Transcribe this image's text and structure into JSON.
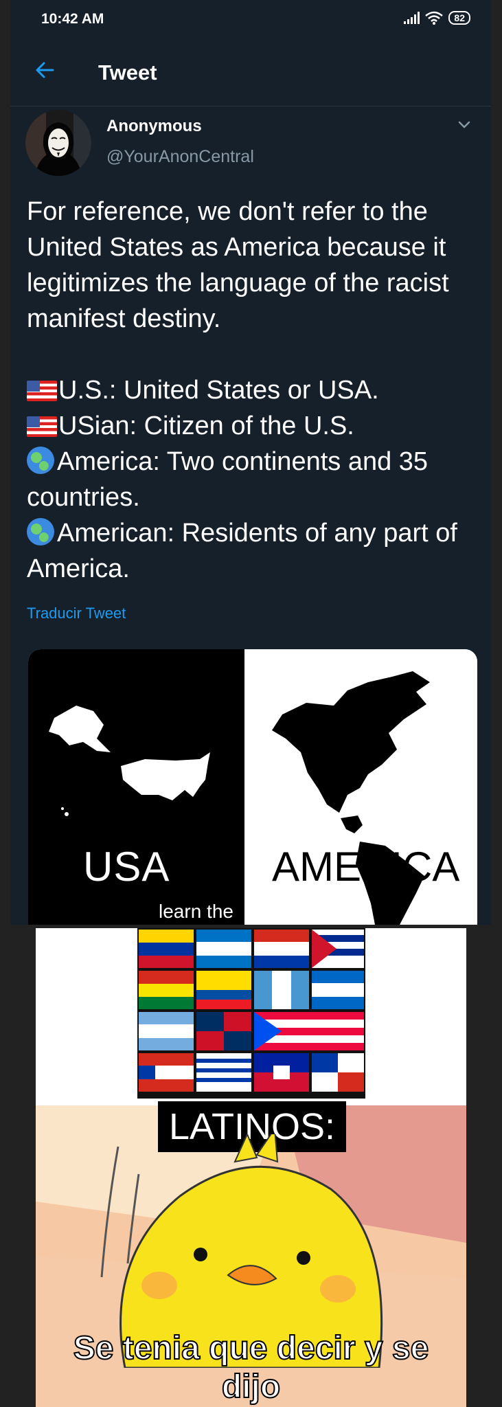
{
  "status_bar": {
    "time": "10:42 AM",
    "battery": "82"
  },
  "header": {
    "title": "Tweet"
  },
  "tweet": {
    "author_name": "Anonymous",
    "author_handle": "@YourAnonCentral",
    "text_intro": "For reference, we don't refer to the United States as America because it legitimizes the language of the racist manifest destiny.",
    "definitions": [
      {
        "icon": "us-flag-emoji",
        "text": "U.S.: United States or USA."
      },
      {
        "icon": "us-flag-emoji",
        "text": "USian: Citizen of the U.S."
      },
      {
        "icon": "globe-americas-emoji",
        "text": "America: Two continents and 35 countries."
      },
      {
        "icon": "globe-americas-emoji",
        "text": "American: Residents of any part of America."
      }
    ],
    "translate_label": "Traducir Tweet"
  },
  "image1": {
    "left_label": "USA",
    "right_label": "AMERICA",
    "bottom_label": "learn the"
  },
  "image2": {
    "label": "LATINOS:",
    "caption_line1": "Se tenia que decir y se",
    "caption_line2": "dijo"
  },
  "colors": {
    "background": "#15202b",
    "accent": "#1d9bf0",
    "secondary_text": "#8899a6",
    "chick": "#f7e21c"
  }
}
